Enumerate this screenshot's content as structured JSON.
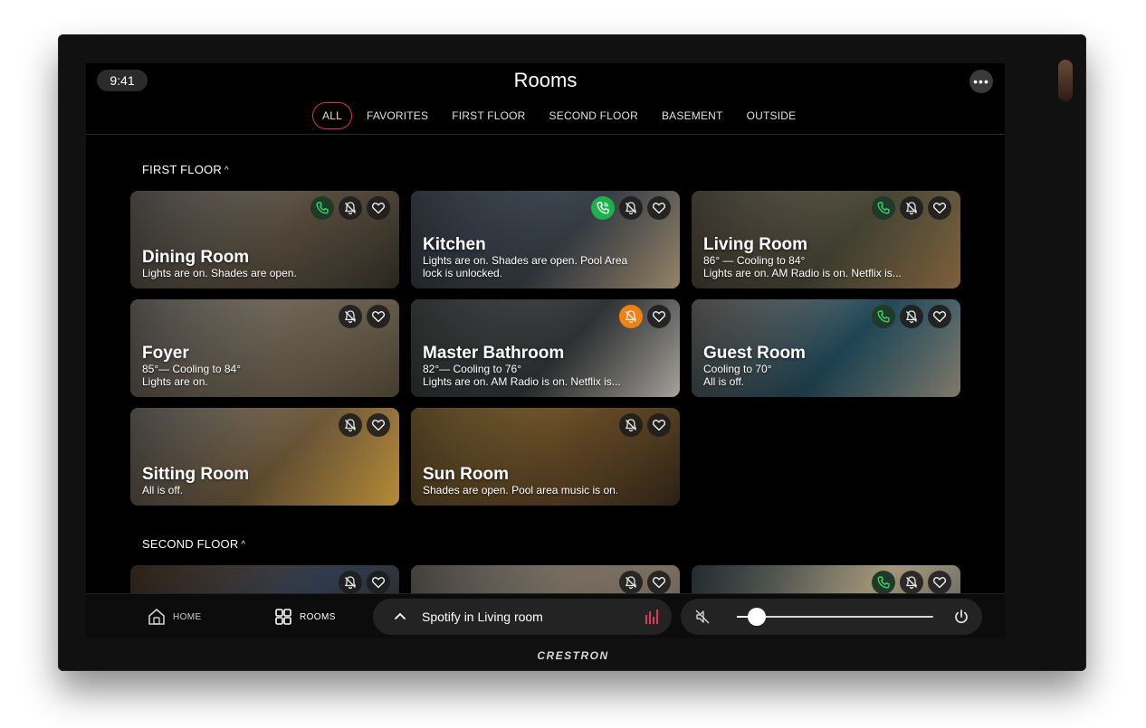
{
  "device": {
    "brand": "CRESTRON"
  },
  "header": {
    "time": "9:41",
    "title": "Rooms",
    "more_icon": "more-icon"
  },
  "tabs": [
    {
      "label": "ALL",
      "active": true
    },
    {
      "label": "FAVORITES",
      "active": false
    },
    {
      "label": "FIRST FLOOR",
      "active": false
    },
    {
      "label": "SECOND FLOOR",
      "active": false
    },
    {
      "label": "BASEMENT",
      "active": false
    },
    {
      "label": "OUTSIDE",
      "active": false
    }
  ],
  "sections": [
    {
      "title": "FIRST FLOOR",
      "rooms": [
        {
          "name": "Dining Room",
          "status": [
            "Lights are on. Shades are open."
          ],
          "intercom": "dark",
          "alert": "muted",
          "favorite": true,
          "palette": [
            "#c8c1b5",
            "#6e5f4c",
            "#2b2a22"
          ]
        },
        {
          "name": "Kitchen",
          "status": [
            "Lights are on. Shades are open. Pool Area",
            "lock is unlocked."
          ],
          "intercom": "active",
          "alert": "muted",
          "favorite": true,
          "palette": [
            "#7f93a8",
            "#48505a",
            "#a89270"
          ]
        },
        {
          "name": "Living Room",
          "status": [
            "86° — Cooling to 84°",
            "Lights are on. AM Radio is on. Netflix is..."
          ],
          "intercom": "dark",
          "alert": "muted",
          "favorite": true,
          "palette": [
            "#b6a98f",
            "#5b5a45",
            "#8c6a3f"
          ]
        },
        {
          "name": "Foyer",
          "status": [
            "85°— Cooling to 84°",
            "Lights are on."
          ],
          "intercom": null,
          "alert": "muted",
          "favorite": true,
          "palette": [
            "#ddd5c9",
            "#8a7c66",
            "#4b4232"
          ]
        },
        {
          "name": "Master Bathroom",
          "status": [
            "82°— Cooling to 76°",
            "Lights are on. AM Radio is on. Netflix is..."
          ],
          "intercom": null,
          "alert": "alarm",
          "favorite": true,
          "palette": [
            "#8c8f90",
            "#3f4244",
            "#b9b5ad"
          ]
        },
        {
          "name": "Guest Room",
          "status": [
            "Cooling to 70°",
            "All is off."
          ],
          "intercom": "dark",
          "alert": "muted",
          "favorite": true,
          "palette": [
            "#dcd8cf",
            "#2a5e74",
            "#8f8773"
          ]
        },
        {
          "name": "Sitting Room",
          "status": [
            "All is off."
          ],
          "intercom": null,
          "alert": "muted",
          "favorite": true,
          "palette": [
            "#d7d1c6",
            "#8d7148",
            "#c99b3a"
          ]
        },
        {
          "name": "Sun Room",
          "status": [
            "Shades are open. Pool area music is on."
          ],
          "intercom": null,
          "alert": "muted",
          "favorite": true,
          "palette": [
            "#f0c064",
            "#7b5a2e",
            "#2e2416"
          ]
        }
      ]
    },
    {
      "title": "SECOND FLOOR",
      "rooms": [
        {
          "name": "",
          "status": [],
          "intercom": null,
          "alert": "muted",
          "favorite": true,
          "palette": [
            "#8b6a4a",
            "#3d4c63",
            "#2a2118"
          ]
        },
        {
          "name": "",
          "status": [],
          "intercom": null,
          "alert": "muted",
          "favorite": true,
          "palette": [
            "#d0c8bd",
            "#9b8d7a",
            "#6b5e4d"
          ]
        },
        {
          "name": "",
          "status": [],
          "intercom": "dark",
          "alert": "muted",
          "favorite": true,
          "palette": [
            "#6b8894",
            "#d2c09a",
            "#3c4a52"
          ]
        }
      ]
    }
  ],
  "bottom_bar": {
    "nav": [
      {
        "label": "HOME",
        "icon": "home-icon"
      },
      {
        "label": "ROOMS",
        "icon": "rooms-grid-icon"
      }
    ],
    "media": {
      "label": "Spotify in Living room",
      "icon": "equalizer-icon",
      "accent": "#e0335f"
    },
    "volume": {
      "level": 0.1,
      "muted": true
    }
  },
  "colors": {
    "accent": "#e02c62",
    "intercom_active": "#19b34a",
    "alarm": "#f0820f",
    "intercom_icon": "#3ad46a"
  }
}
